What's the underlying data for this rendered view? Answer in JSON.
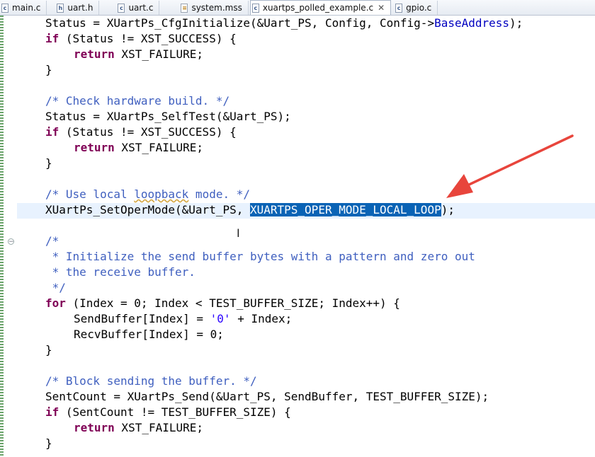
{
  "tabs": [
    {
      "label": "main.c",
      "icon": "c-file-icon"
    },
    {
      "label": "uart.h",
      "icon": "h-file-icon"
    },
    {
      "label": "uart.c",
      "icon": "c-file-icon"
    },
    {
      "label": "system.mss",
      "icon": "mss-file-icon"
    },
    {
      "label": "xuartps_polled_example.c",
      "icon": "c-file-icon",
      "active": true
    },
    {
      "label": "gpio.c",
      "icon": "c-file-icon"
    }
  ],
  "code": {
    "l1": {
      "a": "Status = XUartPs_CfgInitialize(&Uart_PS, Config, Config->",
      "b": "BaseAddress",
      "c": ");"
    },
    "l2": {
      "kw": "if",
      "rest": " (Status != XST_SUCCESS) {"
    },
    "l3": {
      "kw": "return",
      "rest": " XST_FAILURE;"
    },
    "l4": "}",
    "l6": "/* Check hardware build. */",
    "l7": "Status = XUartPs_SelfTest(&Uart_PS);",
    "l8": {
      "kw": "if",
      "rest": " (Status != XST_SUCCESS) {"
    },
    "l9": {
      "kw": "return",
      "rest": " XST_FAILURE;"
    },
    "l10": "}",
    "l12": {
      "a": "/* Use local ",
      "b": "loopback",
      "c": " mode. */"
    },
    "l13": {
      "a": "XUartPs_SetOperMode(&Uart_PS, ",
      "sel": "XUARTPS_OPER_MODE_LOCAL_LOOP",
      "c": ");"
    },
    "l15": "/*",
    "l16": " * Initialize the send buffer bytes with a pattern and zero out",
    "l17": " * the receive buffer.",
    "l18": " */",
    "l19": {
      "kw": "for",
      "rest": " (Index = 0; Index < TEST_BUFFER_SIZE; Index++) {"
    },
    "l20": {
      "a": "SendBuffer[Index] = ",
      "str": "'0'",
      "c": " + Index;"
    },
    "l21": "RecvBuffer[Index] = 0;",
    "l22": "}",
    "l24": "/* Block sending the buffer. */",
    "l25": "SentCount = XUartPs_Send(&Uart_PS, SendBuffer, TEST_BUFFER_SIZE);",
    "l26": {
      "kw": "if",
      "rest": " (SentCount != TEST_BUFFER_SIZE) {"
    },
    "l27": {
      "kw": "return",
      "rest": " XST_FAILURE;"
    },
    "l28": "}"
  },
  "fold_symbol": "−",
  "colors": {
    "keyword": "#7f0055",
    "comment": "#3f5fbf",
    "selection": "#0a63b5",
    "arrow": "#e8453c"
  }
}
